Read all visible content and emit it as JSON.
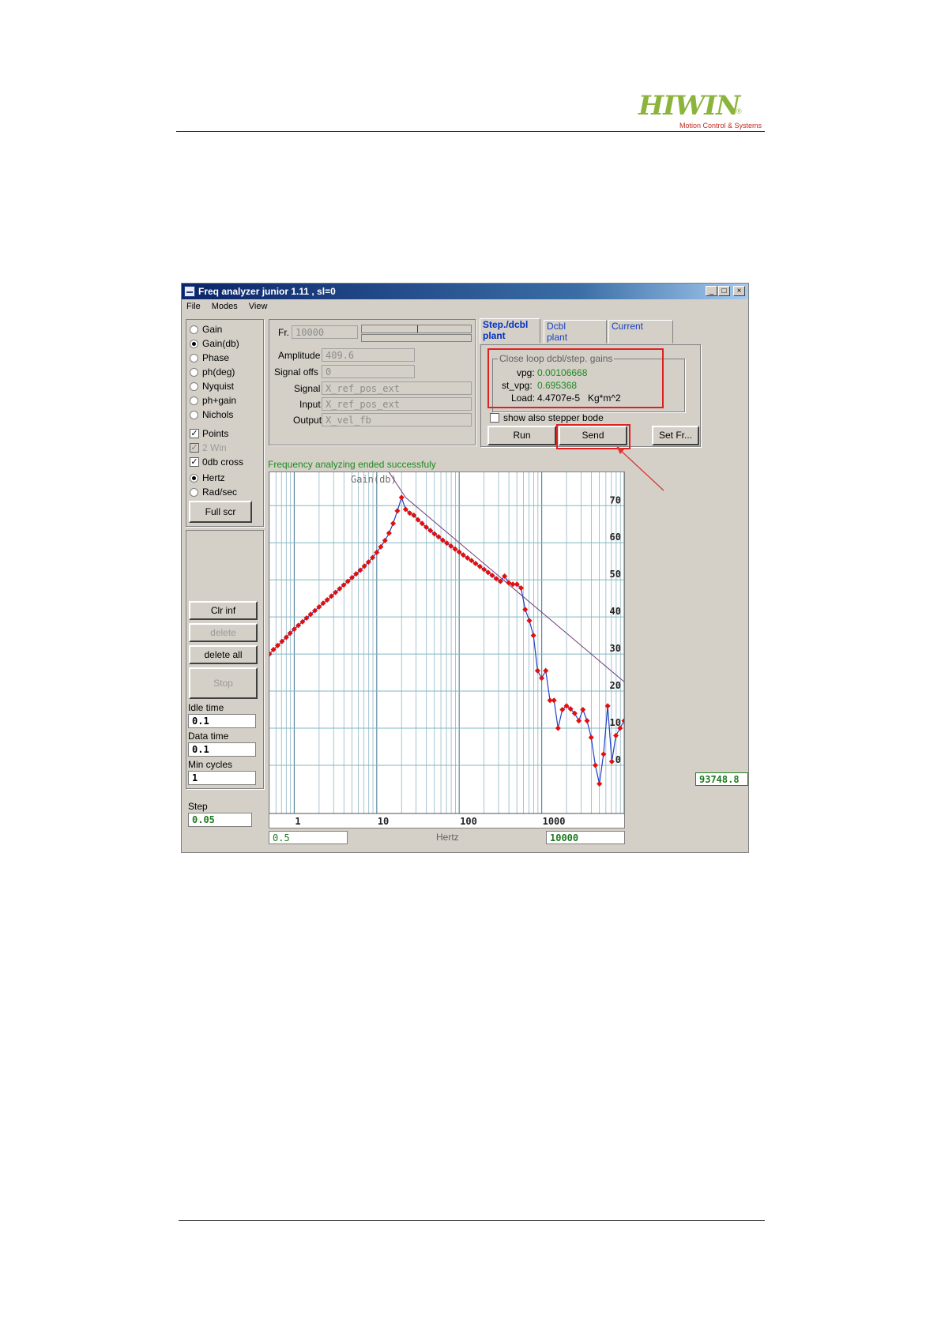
{
  "logo": {
    "brand": "HIWIN",
    "registered": "®",
    "tagline": "Motion Control & Systems"
  },
  "window": {
    "title": "Freq analyzer junior 1.11 , sl=0",
    "controls": {
      "minimize": "_",
      "maximize": "□",
      "close": "×"
    },
    "menu": [
      "File",
      "Modes",
      "View"
    ]
  },
  "left_panel": {
    "modes": [
      {
        "label": "Gain",
        "selected": false
      },
      {
        "label": "Gain(db)",
        "selected": true
      },
      {
        "label": "Phase",
        "selected": false
      },
      {
        "label": "ph(deg)",
        "selected": false
      },
      {
        "label": "Nyquist",
        "selected": false
      },
      {
        "label": "ph+gain",
        "selected": false
      },
      {
        "label": "Nichols",
        "selected": false
      }
    ],
    "options": [
      {
        "label": "Points",
        "checked": true,
        "enabled": true
      },
      {
        "label": "2 Win",
        "checked": true,
        "enabled": false
      },
      {
        "label": "0db cross",
        "checked": true,
        "enabled": true
      }
    ],
    "units": [
      {
        "label": "Hertz",
        "selected": true
      },
      {
        "label": "Rad/sec",
        "selected": false
      }
    ],
    "full_scr": "Full scr",
    "clr_inf": "Clr inf",
    "delete": "delete",
    "delete_all": "delete all",
    "stop": "Stop",
    "idle_time_label": "Idle time",
    "idle_time": "0.1",
    "data_time_label": "Data time",
    "data_time": "0.1",
    "min_cycles_label": "Min cycles",
    "min_cycles": "1",
    "step_label": "Step",
    "step": "0.05"
  },
  "params": {
    "fr_label": "Fr.",
    "fr_value": "10000",
    "amplitude_label": "Amplitude",
    "amplitude": "409.6",
    "signal_offs_label": "Signal offs",
    "signal_offs": "0",
    "signal_label": "Signal",
    "signal": "X_ref_pos_ext",
    "input_label": "Input",
    "input": "X_ref_pos_ext",
    "output_label": "Output",
    "output": "X_vel_fb"
  },
  "tabs": [
    {
      "line1": "Step./dcbl",
      "line2": "plant",
      "active": true
    },
    {
      "line1": "Dcbl",
      "line2": "plant",
      "active": false
    },
    {
      "line1": "Current",
      "line2": "",
      "active": false
    }
  ],
  "gains": {
    "group_title": "Close loop dcbl/step. gains",
    "vpg_label": "vpg:",
    "vpg": "0.00106668",
    "st_vpg_label": "st_vpg:",
    "st_vpg": "0.695368",
    "load_label": "Load:",
    "load": "4.4707e-5",
    "load_unit": "Kg*m^2",
    "show_stepper_bode": "show also stepper bode",
    "show_stepper_bode_checked": false,
    "run": "Run",
    "send": "Send",
    "set_fr": "Set Fr..."
  },
  "status": "Frequency analyzing ended successfuly",
  "plot": {
    "title": "Gain(db)",
    "x_unit": "Hertz",
    "x_min_value": "0.5",
    "x_max_value": "10000",
    "readout": "93748.8"
  },
  "chart_data": {
    "type": "line",
    "title": "Gain(db)",
    "xlabel": "Hertz",
    "ylabel": "",
    "x_scale": "log",
    "xlim": [
      0.5,
      10000
    ],
    "ylim": [
      -13,
      79
    ],
    "x_ticks": [
      "1",
      "10",
      "100",
      "1000"
    ],
    "y_ticks": [
      "0",
      "10",
      "20",
      "30",
      "40",
      "50",
      "60",
      "70"
    ],
    "grid": true,
    "series": [
      {
        "color": "#e01010",
        "line_color": "#2040c0",
        "markers": true,
        "x": [
          0.5,
          0.56,
          0.63,
          0.71,
          0.8,
          0.89,
          1,
          1.12,
          1.26,
          1.41,
          1.58,
          1.78,
          2,
          2.24,
          2.51,
          2.82,
          3.16,
          3.55,
          3.98,
          4.47,
          5.01,
          5.62,
          6.31,
          7.08,
          7.94,
          8.91,
          10,
          11.2,
          12.6,
          14.1,
          15.8,
          17.8,
          20,
          22.4,
          25.1,
          28.2,
          31.6,
          35.5,
          39.8,
          44.7,
          50.1,
          56.2,
          63.1,
          70.8,
          79.4,
          89.1,
          100,
          112,
          126,
          141,
          158,
          178,
          200,
          224,
          251,
          282,
          316,
          355,
          398,
          447,
          501,
          562,
          631,
          708,
          794,
          891,
          1000,
          1120,
          1260,
          1410,
          1580,
          1780,
          2000,
          2240,
          2510,
          2820,
          3160,
          3550,
          3980,
          4470,
          5010,
          5620,
          6310,
          7080,
          7940,
          8910,
          10000
        ],
        "y": [
          30,
          31.2,
          32.3,
          33.4,
          34.5,
          35.6,
          36.7,
          37.7,
          38.7,
          39.7,
          40.7,
          41.7,
          42.7,
          43.7,
          44.6,
          45.6,
          46.6,
          47.6,
          48.6,
          49.6,
          50.6,
          51.6,
          52.6,
          53.7,
          54.8,
          56,
          57.4,
          58.9,
          60.6,
          62.6,
          65.2,
          68.6,
          72.2,
          69,
          68,
          67.4,
          66.2,
          65.2,
          64.2,
          63.3,
          62.4,
          61.6,
          60.7,
          59.9,
          59.1,
          58.3,
          57.5,
          56.7,
          55.9,
          55.2,
          54.4,
          53.6,
          52.8,
          52,
          51.2,
          50.3,
          49.6,
          51,
          49.2,
          48.8,
          48.8,
          47.8,
          42,
          39,
          35,
          25.5,
          23.5,
          25.5,
          17.5,
          17.5,
          10,
          15,
          16,
          15.2,
          14,
          12,
          15,
          12,
          7.5,
          0,
          -5,
          3,
          16,
          1,
          8,
          10,
          12
        ]
      }
    ],
    "asymptote": {
      "x": [
        14.1,
        22.4,
        10000
      ],
      "y": [
        79,
        72.2,
        22.5
      ]
    }
  }
}
